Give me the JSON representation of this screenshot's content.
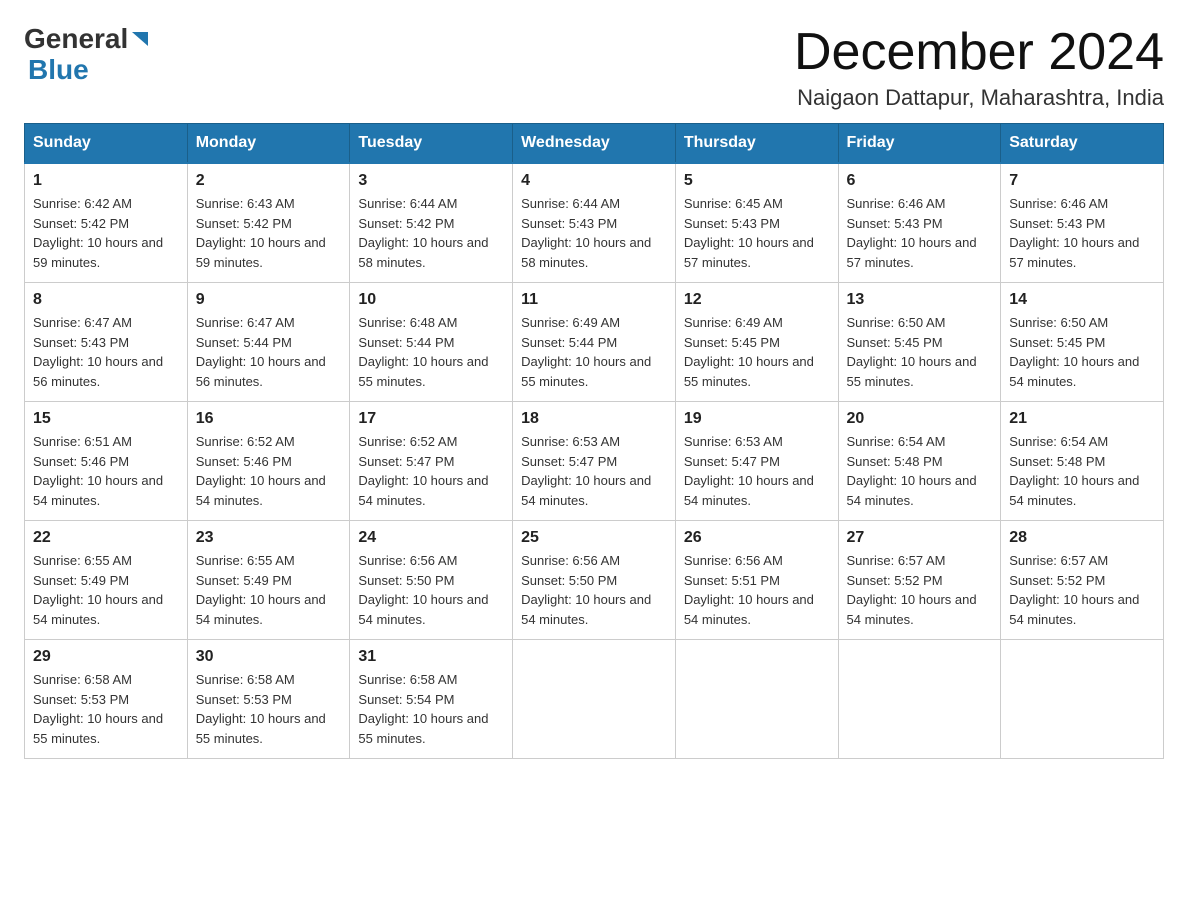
{
  "header": {
    "logo": {
      "part1": "General",
      "part2": "Blue"
    },
    "title": "December 2024",
    "location": "Naigaon Dattapur, Maharashtra, India"
  },
  "days_of_week": [
    "Sunday",
    "Monday",
    "Tuesday",
    "Wednesday",
    "Thursday",
    "Friday",
    "Saturday"
  ],
  "weeks": [
    [
      {
        "day": "1",
        "sunrise": "6:42 AM",
        "sunset": "5:42 PM",
        "daylight": "10 hours and 59 minutes."
      },
      {
        "day": "2",
        "sunrise": "6:43 AM",
        "sunset": "5:42 PM",
        "daylight": "10 hours and 59 minutes."
      },
      {
        "day": "3",
        "sunrise": "6:44 AM",
        "sunset": "5:42 PM",
        "daylight": "10 hours and 58 minutes."
      },
      {
        "day": "4",
        "sunrise": "6:44 AM",
        "sunset": "5:43 PM",
        "daylight": "10 hours and 58 minutes."
      },
      {
        "day": "5",
        "sunrise": "6:45 AM",
        "sunset": "5:43 PM",
        "daylight": "10 hours and 57 minutes."
      },
      {
        "day": "6",
        "sunrise": "6:46 AM",
        "sunset": "5:43 PM",
        "daylight": "10 hours and 57 minutes."
      },
      {
        "day": "7",
        "sunrise": "6:46 AM",
        "sunset": "5:43 PM",
        "daylight": "10 hours and 57 minutes."
      }
    ],
    [
      {
        "day": "8",
        "sunrise": "6:47 AM",
        "sunset": "5:43 PM",
        "daylight": "10 hours and 56 minutes."
      },
      {
        "day": "9",
        "sunrise": "6:47 AM",
        "sunset": "5:44 PM",
        "daylight": "10 hours and 56 minutes."
      },
      {
        "day": "10",
        "sunrise": "6:48 AM",
        "sunset": "5:44 PM",
        "daylight": "10 hours and 55 minutes."
      },
      {
        "day": "11",
        "sunrise": "6:49 AM",
        "sunset": "5:44 PM",
        "daylight": "10 hours and 55 minutes."
      },
      {
        "day": "12",
        "sunrise": "6:49 AM",
        "sunset": "5:45 PM",
        "daylight": "10 hours and 55 minutes."
      },
      {
        "day": "13",
        "sunrise": "6:50 AM",
        "sunset": "5:45 PM",
        "daylight": "10 hours and 55 minutes."
      },
      {
        "day": "14",
        "sunrise": "6:50 AM",
        "sunset": "5:45 PM",
        "daylight": "10 hours and 54 minutes."
      }
    ],
    [
      {
        "day": "15",
        "sunrise": "6:51 AM",
        "sunset": "5:46 PM",
        "daylight": "10 hours and 54 minutes."
      },
      {
        "day": "16",
        "sunrise": "6:52 AM",
        "sunset": "5:46 PM",
        "daylight": "10 hours and 54 minutes."
      },
      {
        "day": "17",
        "sunrise": "6:52 AM",
        "sunset": "5:47 PM",
        "daylight": "10 hours and 54 minutes."
      },
      {
        "day": "18",
        "sunrise": "6:53 AM",
        "sunset": "5:47 PM",
        "daylight": "10 hours and 54 minutes."
      },
      {
        "day": "19",
        "sunrise": "6:53 AM",
        "sunset": "5:47 PM",
        "daylight": "10 hours and 54 minutes."
      },
      {
        "day": "20",
        "sunrise": "6:54 AM",
        "sunset": "5:48 PM",
        "daylight": "10 hours and 54 minutes."
      },
      {
        "day": "21",
        "sunrise": "6:54 AM",
        "sunset": "5:48 PM",
        "daylight": "10 hours and 54 minutes."
      }
    ],
    [
      {
        "day": "22",
        "sunrise": "6:55 AM",
        "sunset": "5:49 PM",
        "daylight": "10 hours and 54 minutes."
      },
      {
        "day": "23",
        "sunrise": "6:55 AM",
        "sunset": "5:49 PM",
        "daylight": "10 hours and 54 minutes."
      },
      {
        "day": "24",
        "sunrise": "6:56 AM",
        "sunset": "5:50 PM",
        "daylight": "10 hours and 54 minutes."
      },
      {
        "day": "25",
        "sunrise": "6:56 AM",
        "sunset": "5:50 PM",
        "daylight": "10 hours and 54 minutes."
      },
      {
        "day": "26",
        "sunrise": "6:56 AM",
        "sunset": "5:51 PM",
        "daylight": "10 hours and 54 minutes."
      },
      {
        "day": "27",
        "sunrise": "6:57 AM",
        "sunset": "5:52 PM",
        "daylight": "10 hours and 54 minutes."
      },
      {
        "day": "28",
        "sunrise": "6:57 AM",
        "sunset": "5:52 PM",
        "daylight": "10 hours and 54 minutes."
      }
    ],
    [
      {
        "day": "29",
        "sunrise": "6:58 AM",
        "sunset": "5:53 PM",
        "daylight": "10 hours and 55 minutes."
      },
      {
        "day": "30",
        "sunrise": "6:58 AM",
        "sunset": "5:53 PM",
        "daylight": "10 hours and 55 minutes."
      },
      {
        "day": "31",
        "sunrise": "6:58 AM",
        "sunset": "5:54 PM",
        "daylight": "10 hours and 55 minutes."
      },
      null,
      null,
      null,
      null
    ]
  ],
  "labels": {
    "sunrise_prefix": "Sunrise: ",
    "sunset_prefix": "Sunset: ",
    "daylight_prefix": "Daylight: "
  },
  "colors": {
    "header_bg": "#2176ae",
    "header_text": "#ffffff",
    "border": "#cccccc",
    "accent_blue": "#2176ae"
  }
}
